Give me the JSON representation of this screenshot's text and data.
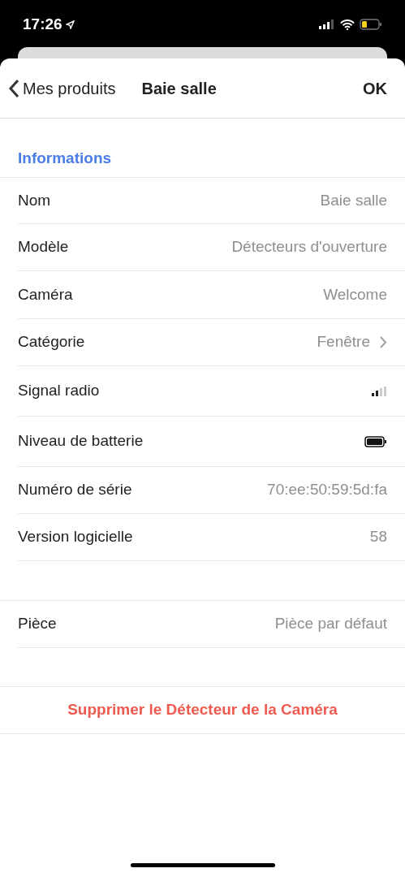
{
  "status_bar": {
    "time": "17:26"
  },
  "nav": {
    "back": "Mes produits",
    "title": "Baie salle",
    "done": "OK"
  },
  "section": {
    "title": "Informations"
  },
  "rows": [
    {
      "kind": "text",
      "label": "Nom",
      "value": "Baie salle"
    },
    {
      "kind": "text",
      "label": "Modèle",
      "value": "Détecteurs d'ouverture"
    },
    {
      "kind": "text",
      "label": "Caméra",
      "value": "Welcome"
    },
    {
      "kind": "link",
      "label": "Catégorie",
      "value": "Fenêtre"
    },
    {
      "kind": "signal",
      "label": "Signal radio"
    },
    {
      "kind": "battery",
      "label": "Niveau de batterie"
    },
    {
      "kind": "text",
      "label": "Numéro de série",
      "value": "70:ee:50:59:5d:fa"
    },
    {
      "kind": "text",
      "label": "Version logicielle",
      "value": "58"
    }
  ],
  "room": {
    "label": "Pièce",
    "value": "Pièce par défaut"
  },
  "delete": "Supprimer le Détecteur de la Caméra"
}
